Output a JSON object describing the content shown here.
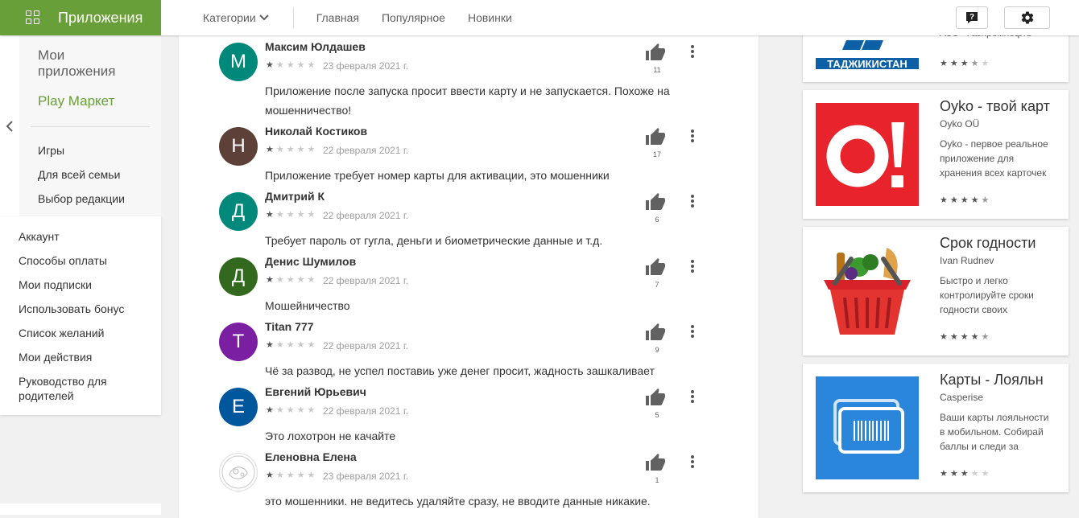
{
  "brand": {
    "title": "Приложения",
    "color": "#689f38"
  },
  "topnav": {
    "categories": "Категории",
    "links": [
      "Главная",
      "Популярное",
      "Новинки"
    ],
    "help_icon": "help-icon",
    "settings_icon": "gear-icon"
  },
  "sidebar": {
    "my_apps": "Мои приложения",
    "play_market": "Play Маркет",
    "categories": [
      "Игры",
      "Для всей семьи",
      "Выбор редакции"
    ],
    "account": [
      "Аккаунт",
      "Способы оплаты",
      "Мои подписки",
      "Использовать бонус",
      "Список желаний",
      "Мои действия",
      "Руководство для родителей"
    ]
  },
  "reviews": [
    {
      "initial": "М",
      "color": "#00897b",
      "name": "Максим Юлдашев",
      "rating": 1,
      "date": "23 февраля 2021 г.",
      "likes": "11",
      "text": "Приложение после запуска просит ввести карту и не запускается. Похоже на мошенничество!"
    },
    {
      "initial": "Н",
      "color": "#5d4037",
      "name": "Николай Костиков",
      "rating": 1,
      "date": "22 февраля 2021 г.",
      "likes": "17",
      "text": "Приложение требует номер карты для активации, это мошенники"
    },
    {
      "initial": "Д",
      "color": "#00897b",
      "name": "Дмитрий К",
      "rating": 1,
      "date": "22 февраля 2021 г.",
      "likes": "6",
      "text": "Требует пароль от гугла, деньги и биометрические данные и т.д."
    },
    {
      "initial": "Д",
      "color": "#33691e",
      "name": "Денис Шумилов",
      "rating": 1,
      "date": "22 февраля 2021 г.",
      "likes": "7",
      "text": "Мошейничество"
    },
    {
      "initial": "T",
      "color": "#7b1fa2",
      "name": "Titan 777",
      "rating": 1,
      "date": "22 февраля 2021 г.",
      "likes": "9",
      "text": "Чё за развод, не успел поставиь уже денег просит, жадность зашкаливает"
    },
    {
      "initial": "Е",
      "color": "#01579b",
      "name": "Евгений Юрьевич",
      "rating": 1,
      "date": "22 февраля 2021 г.",
      "likes": "5",
      "text": "Это лохотрон не качайте"
    },
    {
      "initial": "",
      "color": "#ffffff",
      "name": "Еленовна Елена",
      "rating": 1,
      "date": "23 февраля 2021 г.",
      "likes": "1",
      "text": "это мошенники. не ведитесь удаляйте сразу, не вводите данные никакие."
    }
  ],
  "cards": [
    {
      "title": "",
      "developer": "АЗС «Газпромнефть»",
      "banner": "ТАДЖИКИСТАН",
      "description": "",
      "rating": 3.5,
      "icon": "gazprom-icon"
    },
    {
      "title": "Oyko - твой карт",
      "developer": "Oyko OÜ",
      "description": "Oyko - первое реальное приложение для хранения всех карточек",
      "rating": 4.5,
      "icon": "oyko-icon",
      "icon_text": "O!"
    },
    {
      "title": "Срок годности",
      "developer": "Ivan Rudnev",
      "description": "Быстро и легко контролируйте сроки годности своих",
      "rating": 4.5,
      "icon": "basket-icon"
    },
    {
      "title": "Карты - Лояльн",
      "developer": "Casperise",
      "description": "Ваши карты лояльности в мобильном. Собирай баллы и следи за",
      "rating": 3,
      "icon": "barcode-card-icon"
    }
  ]
}
